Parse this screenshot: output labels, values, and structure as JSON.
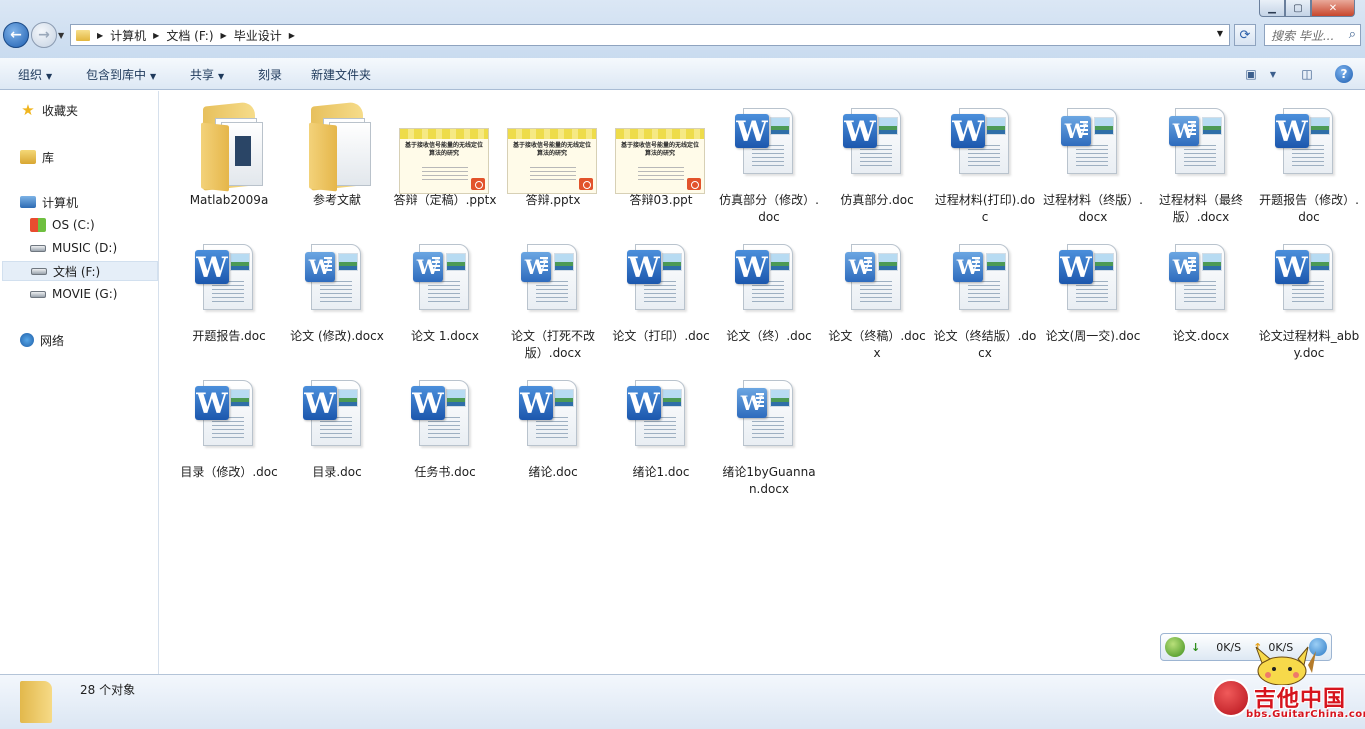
{
  "window": {
    "breadcrumb": [
      "计算机",
      "文档 (F:)",
      "毕业设计"
    ],
    "search_placeholder": "搜索 毕业...",
    "caption_buttons": [
      "minimize",
      "maximize",
      "close"
    ]
  },
  "toolbar": {
    "organize": "组织",
    "include_in_library": "包含到库中",
    "share": "共享",
    "burn": "刻录",
    "new_folder": "新建文件夹"
  },
  "nav": {
    "favorites": "收藏夹",
    "libraries": "库",
    "computer": "计算机",
    "drives": [
      "OS (C:)",
      "MUSIC (D:)",
      "文档 (F:)",
      "MOVIE (G:)"
    ],
    "selected_drive": "文档 (F:)",
    "network": "网络"
  },
  "files": [
    {
      "name": "Matlab2009a",
      "type": "folder"
    },
    {
      "name": "参考文献",
      "type": "folder"
    },
    {
      "name": "答辩（定稿）.pptx",
      "type": "ppt"
    },
    {
      "name": "答辩.pptx",
      "type": "ppt"
    },
    {
      "name": "答辩03.ppt",
      "type": "ppt"
    },
    {
      "name": "仿真部分（修改）.doc",
      "type": "doc"
    },
    {
      "name": "仿真部分.doc",
      "type": "doc"
    },
    {
      "name": "过程材料(打印).doc",
      "type": "doc"
    },
    {
      "name": "过程材料（终版）.docx",
      "type": "docx"
    },
    {
      "name": "过程材料（最终版）.docx",
      "type": "docx"
    },
    {
      "name": "开题报告（修改）.doc",
      "type": "doc"
    },
    {
      "name": "开题报告.doc",
      "type": "doc"
    },
    {
      "name": "论文 (修改).docx",
      "type": "docx"
    },
    {
      "name": "论文 1.docx",
      "type": "docx"
    },
    {
      "name": "论文（打死不改版）.docx",
      "type": "docx"
    },
    {
      "name": "论文（打印）.doc",
      "type": "doc"
    },
    {
      "name": "论文（终）.doc",
      "type": "doc"
    },
    {
      "name": "论文（终稿）.docx",
      "type": "docx"
    },
    {
      "name": "论文（终结版）.docx",
      "type": "docx"
    },
    {
      "name": "论文(周一交).doc",
      "type": "doc"
    },
    {
      "name": "论文.docx",
      "type": "docx"
    },
    {
      "name": "论文过程材料_abby.doc",
      "type": "doc"
    },
    {
      "name": "目录（修改）.doc",
      "type": "doc"
    },
    {
      "name": "目录.doc",
      "type": "doc"
    },
    {
      "name": "任务书.doc",
      "type": "doc"
    },
    {
      "name": "绪论.doc",
      "type": "doc"
    },
    {
      "name": "绪论1.doc",
      "type": "doc"
    },
    {
      "name": "绪论1byGuannan.docx",
      "type": "docx"
    }
  ],
  "ppt_thumb_title": "基于接收信号能量的无线定位算法的研究",
  "details": {
    "count": "28 个对象"
  },
  "speed_widget": {
    "down": "0K/S",
    "up": "0K/S"
  },
  "watermark": {
    "text": "吉他中国",
    "url": "bbs.GuitarChina.com"
  },
  "colors": {
    "accent": "#1f5fb0",
    "selection": "#e5eef8"
  }
}
